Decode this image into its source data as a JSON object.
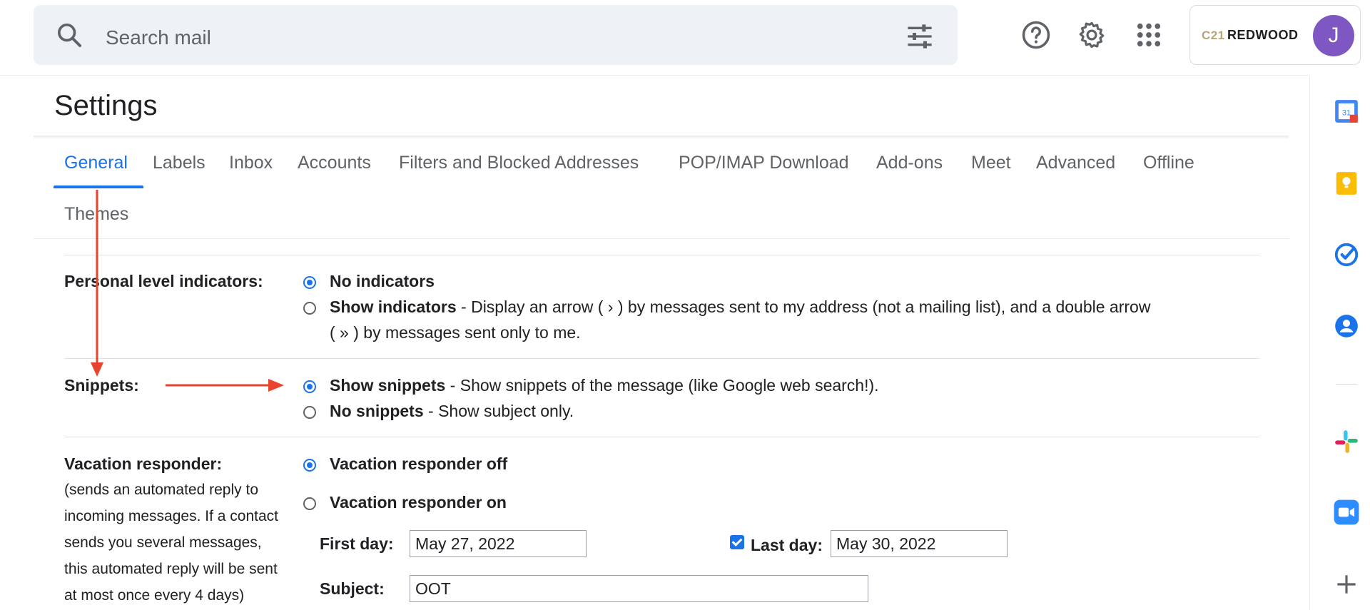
{
  "search": {
    "placeholder": "Search mail"
  },
  "account": {
    "brand_prefix": "C21",
    "brand_name": "REDWOOD",
    "avatar_initial": "J"
  },
  "page": {
    "title": "Settings"
  },
  "tabs": [
    "General",
    "Labels",
    "Inbox",
    "Accounts",
    "Filters and Blocked Addresses",
    "POP/IMAP Download",
    "Add-ons",
    "Meet",
    "Advanced",
    "Offline",
    "Themes"
  ],
  "personal_indicators": {
    "label": "Personal level indicators:",
    "opt1_title": "No indicators",
    "opt2_title": "Show indicators",
    "opt2_desc_line1": " - Display an arrow ( › ) by messages sent to my address (not a mailing list), and a double arrow",
    "opt2_desc_line2": "( » ) by messages sent only to me."
  },
  "snippets": {
    "label": "Snippets:",
    "opt1_title": "Show snippets",
    "opt1_desc": " - Show snippets of the message (like Google web search!).",
    "opt2_title": "No snippets",
    "opt2_desc": " - Show subject only."
  },
  "vacation": {
    "label": "Vacation responder:",
    "help_lines": [
      "(sends an automated reply to",
      "incoming messages. If a contact",
      "sends you several messages,",
      "this automated reply will be sent",
      "at most once every 4 days)"
    ],
    "opt_off": "Vacation responder off",
    "opt_on": "Vacation responder on",
    "first_day_label": "First day:",
    "first_day_value": "May 27, 2022",
    "last_day_label": "Last day:",
    "last_day_value": "May 30, 2022",
    "subject_label": "Subject:",
    "subject_value": "OOT"
  },
  "colors": {
    "accent": "#1a73e8",
    "annotation_arrow": "#e8432c",
    "avatar": "#7e57c2"
  },
  "side_panel_icons": [
    "calendar-icon",
    "keep-icon",
    "tasks-icon",
    "contacts-icon",
    "slack-icon",
    "zoom-icon",
    "add-icon"
  ]
}
